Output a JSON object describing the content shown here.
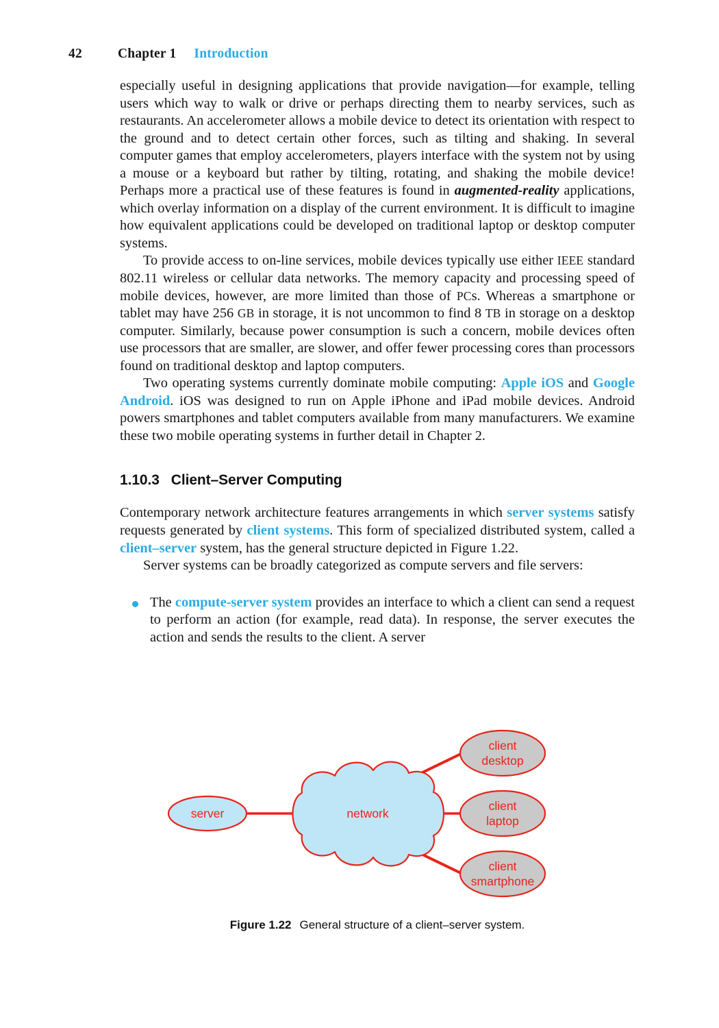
{
  "header": {
    "page_number": "42",
    "chapter": "Chapter 1",
    "chapter_title": "Introduction",
    "accent_color": "#2BABE2"
  },
  "body": {
    "paragraph_1": {
      "part_a": "especially useful in designing applications that provide navigation—for example, telling users which way to walk or drive or perhaps directing them to nearby services, such as restaurants. An accelerometer allows a mobile device to detect its orientation with respect to the ground and to detect certain other forces, such as tilting and shaking. In several computer games that employ accelerometers, players interface with the system not by using a mouse or a keyboard but rather by tilting, rotating, and shaking the mobile device! Perhaps more a practical use of these features is found in ",
      "emphasis": "augmented-reality",
      "part_b": " applications, which overlay information on a display of the current environment. It is difficult to imagine how equivalent applications could be developed on traditional laptop or desktop computer systems."
    },
    "paragraph_2": {
      "part_a": "To provide access to on-line services, mobile devices typically use either ",
      "sc_1": "IEEE",
      "part_b": " standard 802.11 wireless or cellular data networks. The memory capacity and processing speed of mobile devices, however, are more limited than those of ",
      "sc_2": "PC",
      "part_c": "s. Whereas a smartphone or tablet may have 256 ",
      "sc_3": "GB",
      "part_d": " in storage, it is not uncommon to find 8 ",
      "sc_4": "TB",
      "part_e": " in storage on a desktop computer. Similarly, because power consumption is such a concern, mobile devices often use processors that are smaller, are slower, and offer fewer processing cores than processors found on traditional desktop and laptop computers."
    },
    "paragraph_3": {
      "part_a": "Two operating systems currently dominate mobile computing: ",
      "term_1": "Apple iOS",
      "part_b": " and ",
      "term_2": "Google Android",
      "part_c": ". iOS was designed to run on Apple iPhone and iPad mobile devices. Android powers smartphones and tablet computers available from many manufacturers. We examine these two mobile operating systems in further detail in Chapter 2."
    },
    "section_heading": {
      "number": "1.10.3",
      "title": "Client–Server Computing"
    },
    "paragraph_4": {
      "part_a": "Contemporary network architecture features arrangements in which ",
      "term_1": "server systems",
      "part_b": " satisfy requests generated by ",
      "term_2": "client systems",
      "part_c": ". This form of specialized distributed system, called a ",
      "term_3": "client–server",
      "part_d": " system, has the general structure depicted in Figure 1.22."
    },
    "paragraph_5": {
      "text": "Server systems can be broadly categorized as compute servers and file servers:"
    },
    "bullet_1": {
      "part_a": "The ",
      "term_1": "compute-server system",
      "part_b": " provides an interface to which a client can send a request to perform an action (for example, read data). In response, the server executes the action and sends the results to the client. A server"
    }
  },
  "figure": {
    "caption_label": "Figure 1.22",
    "caption_text": "General structure of a client–server system.",
    "colors": {
      "stroke": "#E8231A",
      "cloud_fill": "#BFE6F7",
      "server_fill": "#BFE6F7",
      "client_fill": "#C9C9C9",
      "label": "#E8231A"
    },
    "nodes": {
      "server": "server",
      "network": "network",
      "client_desktop_line1": "client",
      "client_desktop_line2": "desktop",
      "client_laptop_line1": "client",
      "client_laptop_line2": "laptop",
      "client_smartphone_line1": "client",
      "client_smartphone_line2": "smartphone"
    }
  }
}
